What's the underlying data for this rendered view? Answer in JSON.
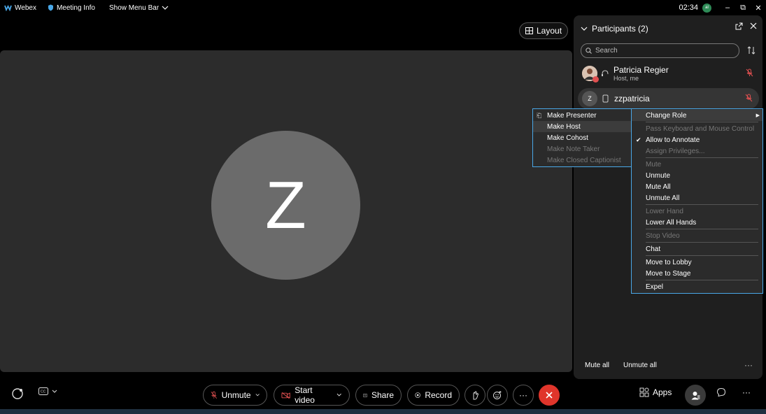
{
  "titlebar": {
    "app_name": "Webex",
    "meeting_info": "Meeting Info",
    "show_menu_bar": "Show Menu Bar",
    "time": "02:34",
    "avatar_initials": "al",
    "minimize": "–",
    "restore": "⧉",
    "close": "✕"
  },
  "stage": {
    "avatar_letter": "Z",
    "layout_label": "Layout"
  },
  "participants": {
    "title": "Participants (2)",
    "search_placeholder": "Search",
    "people": [
      {
        "name": "Patricia Regier",
        "role": "Host, me"
      },
      {
        "name": "zzpatricia",
        "initial": "Z"
      }
    ],
    "mute_all": "Mute all",
    "unmute_all": "Unmute all",
    "more": "···"
  },
  "context_menu": {
    "items": [
      {
        "label": "Change Role",
        "enabled": true,
        "submenu": true
      },
      {
        "label": "Pass Keyboard and Mouse Control",
        "enabled": false
      },
      {
        "label": "Allow to Annotate",
        "enabled": true,
        "checked": true
      },
      {
        "label": "Assign Privileges...",
        "enabled": false
      },
      {
        "label": "Mute",
        "enabled": false
      },
      {
        "label": "Unmute",
        "enabled": true
      },
      {
        "label": "Mute All",
        "enabled": true
      },
      {
        "label": "Unmute All",
        "enabled": true
      },
      {
        "label": "Lower Hand",
        "enabled": false
      },
      {
        "label": "Lower All Hands",
        "enabled": true
      },
      {
        "label": "Stop Video",
        "enabled": false
      },
      {
        "label": "Chat",
        "enabled": true
      },
      {
        "label": "Move to Lobby",
        "enabled": true
      },
      {
        "label": "Move to Stage",
        "enabled": true
      },
      {
        "label": "Expel",
        "enabled": true
      }
    ]
  },
  "role_submenu": {
    "items": [
      {
        "label": "Make Presenter",
        "enabled": true
      },
      {
        "label": "Make Host",
        "enabled": true,
        "highlighted": true
      },
      {
        "label": "Make Cohost",
        "enabled": true
      },
      {
        "label": "Make Note Taker",
        "enabled": false
      },
      {
        "label": "Make Closed Captionist",
        "enabled": false
      }
    ]
  },
  "bottombar": {
    "unmute": "Unmute",
    "start_video": "Start video",
    "share": "Share",
    "record": "Record",
    "more": "···",
    "apps": "Apps",
    "more_right": "···"
  },
  "colors": {
    "accent_blue": "#4aa8e8",
    "end_red": "#e0352b",
    "mute_red": "#e05050"
  }
}
